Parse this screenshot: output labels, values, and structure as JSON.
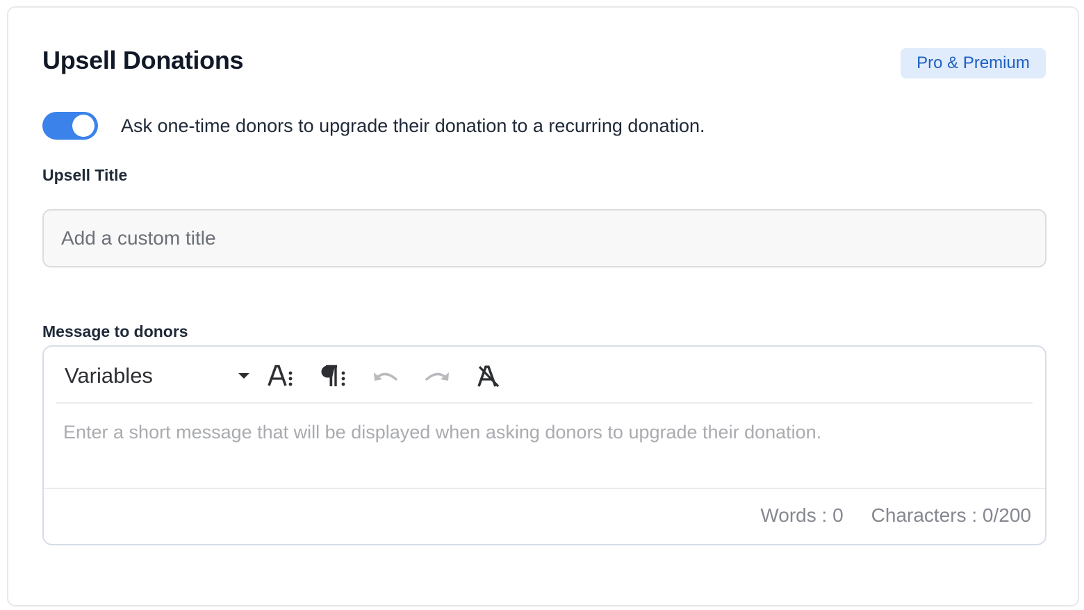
{
  "section": {
    "title": "Upsell Donations",
    "badge": "Pro & Premium"
  },
  "toggle": {
    "on": true,
    "label": "Ask one-time donors to upgrade their donation to a recurring donation."
  },
  "upsell_title": {
    "label": "Upsell Title",
    "value": "",
    "placeholder": "Add a custom title"
  },
  "message": {
    "label": "Message to donors",
    "toolbar": {
      "variables_label": "Variables",
      "tools": [
        "font-size-icon",
        "paragraph-icon",
        "undo-icon",
        "redo-icon",
        "clear-format-icon"
      ]
    },
    "placeholder": "Enter a short message that will be displayed when asking donors to upgrade their donation.",
    "words": "Words : 0",
    "characters": "Characters : 0/200"
  },
  "colors": {
    "accent": "#3b82ea",
    "badge_bg": "#e0ecfb",
    "badge_text": "#1e5fc0"
  }
}
